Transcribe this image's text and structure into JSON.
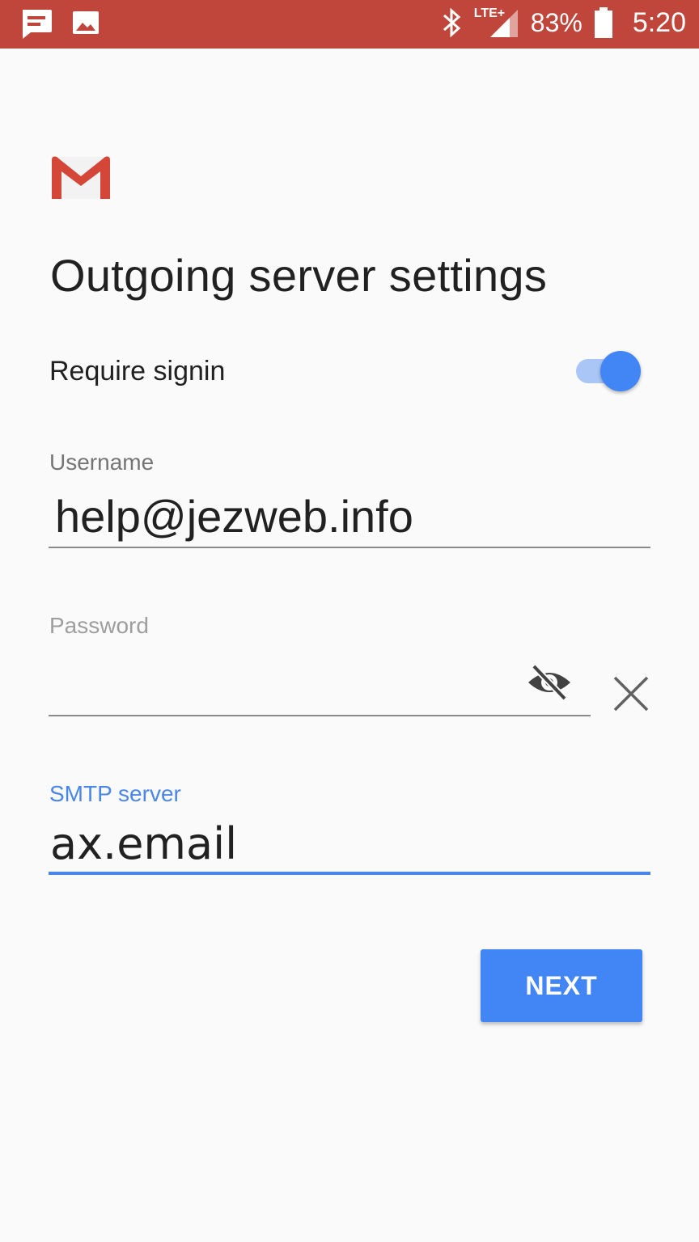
{
  "status_bar": {
    "network": "LTE+",
    "battery_percent": "83%",
    "time": "5:20"
  },
  "icons": {
    "notification_message": "message-icon",
    "notification_image": "image-icon",
    "bluetooth": "bluetooth-icon",
    "signal": "signal-icon",
    "battery": "battery-icon",
    "logo": "gmail-logo",
    "password_visibility": "eye-off-icon",
    "clear": "close-icon"
  },
  "screen": {
    "title": "Outgoing server settings"
  },
  "require_signin": {
    "label": "Require signin",
    "enabled": true
  },
  "username": {
    "label": "Username",
    "value": "help@jezweb.info"
  },
  "password": {
    "label": "Password",
    "value": ""
  },
  "smtp_server": {
    "label": "SMTP server",
    "value": "ax.email"
  },
  "actions": {
    "next_label": "NEXT"
  },
  "colors": {
    "status_bar": "#c0463c",
    "accent": "#4285f4",
    "background": "#fafafa"
  }
}
